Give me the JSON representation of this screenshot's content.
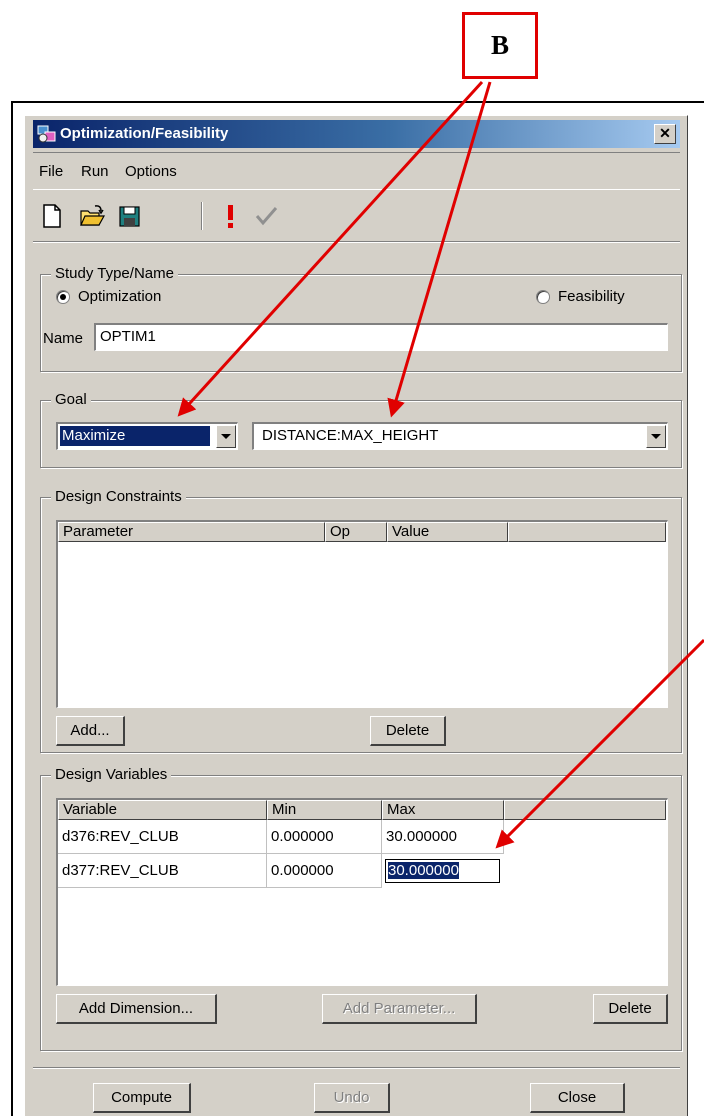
{
  "annotation": {
    "label": "B"
  },
  "window": {
    "title": "Optimization/Feasibility",
    "close_glyph": "✕"
  },
  "menu": {
    "items": [
      "File",
      "Run",
      "Options"
    ]
  },
  "toolbar": {
    "icons": [
      "new-file-icon",
      "open-folder-icon",
      "save-icon",
      "exclamation-icon",
      "checkmark-icon"
    ]
  },
  "study": {
    "group_title": "Study Type/Name",
    "optimization_label": "Optimization",
    "feasibility_label": "Feasibility",
    "selected": "Optimization",
    "name_label": "Name",
    "name_value": "OPTIM1"
  },
  "goal": {
    "group_title": "Goal",
    "mode_value": "Maximize",
    "target_value": "DISTANCE:MAX_HEIGHT"
  },
  "constraints": {
    "group_title": "Design Constraints",
    "columns": [
      "Parameter",
      "Op",
      "Value",
      ""
    ],
    "add_label": "Add...",
    "delete_label": "Delete"
  },
  "variables": {
    "group_title": "Design Variables",
    "columns": [
      "Variable",
      "Min",
      "Max",
      ""
    ],
    "rows": [
      {
        "variable": "d376:REV_CLUB",
        "min": "0.000000",
        "max": "30.000000"
      },
      {
        "variable": "d377:REV_CLUB",
        "min": "0.000000",
        "max": "30.000000"
      }
    ],
    "add_dimension_label": "Add Dimension...",
    "add_parameter_label": "Add Parameter...",
    "delete_label": "Delete"
  },
  "footer": {
    "compute_label": "Compute",
    "undo_label": "Undo",
    "close_label": "Close"
  },
  "colors": {
    "annotation": "#e00000",
    "selection": "#0a246a",
    "title_start": "#0a246a",
    "title_end": "#a6caf0"
  }
}
